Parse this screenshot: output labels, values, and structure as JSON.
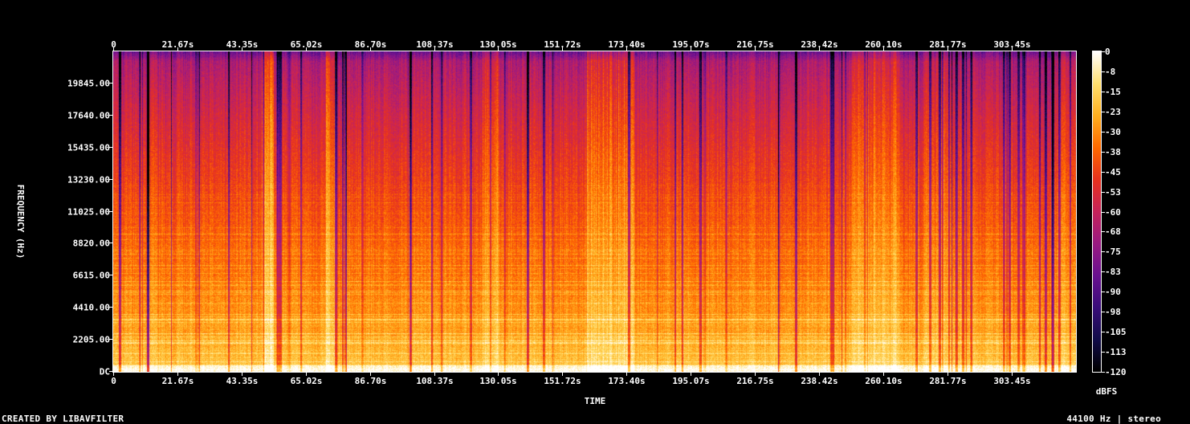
{
  "chart_data": {
    "type": "heatmap",
    "xlabel": "TIME",
    "ylabel": "FREQUENCY (Hz)",
    "x_tick_labels": [
      "0",
      "21.67s",
      "43.35s",
      "65.02s",
      "86.70s",
      "108.37s",
      "130.05s",
      "151.72s",
      "173.40s",
      "195.07s",
      "216.75s",
      "238.42s",
      "260.10s",
      "281.77s",
      "303.45s"
    ],
    "x_tick_values": [
      0,
      21.67,
      43.35,
      65.02,
      86.7,
      108.37,
      130.05,
      151.72,
      173.4,
      195.07,
      216.75,
      238.42,
      260.1,
      281.77,
      303.45
    ],
    "xlim": [
      0,
      325.2
    ],
    "y_tick_labels": [
      "DC",
      "2205.00",
      "4410.00",
      "6615.00",
      "8820.00",
      "11025.00",
      "13230.00",
      "15435.00",
      "17640.00",
      "19845.00"
    ],
    "y_tick_values": [
      0,
      2205,
      4410,
      6615,
      8820,
      11025,
      13230,
      15435,
      17640,
      19845
    ],
    "ylim": [
      0,
      22050
    ],
    "colorbar": {
      "label": "dBFS",
      "tick_labels": [
        "0",
        "-8",
        "-15",
        "-23",
        "-30",
        "-38",
        "-45",
        "-53",
        "-60",
        "-68",
        "-75",
        "-83",
        "-90",
        "-98",
        "-105",
        "-113",
        "-120"
      ],
      "range": [
        -120,
        0
      ],
      "colors": [
        "#000000",
        "#120c4a",
        "#3a0c7a",
        "#6a1190",
        "#9a1a82",
        "#c6235a",
        "#e8321e",
        "#ff6a00",
        "#ffb020",
        "#ffe070",
        "#ffffff"
      ]
    },
    "sample_rate_hz": 44100,
    "channels": "stereo"
  },
  "footer": {
    "left": "CREATED BY LIBAVFILTER",
    "right": "44100 Hz | stereo"
  }
}
